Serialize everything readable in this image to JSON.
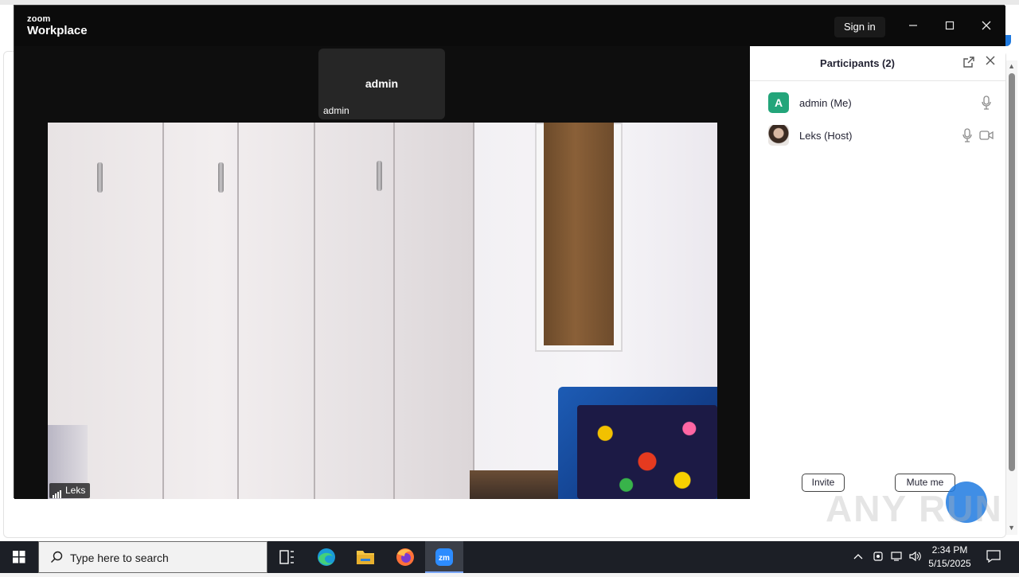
{
  "window": {
    "logo_top": "zoom",
    "logo_bottom": "Workplace",
    "sign_in": "Sign in"
  },
  "stage": {
    "thumbnail_name": "admin",
    "thumbnail_label": "admin",
    "main_video_label": "Leks"
  },
  "participants": {
    "title": "Participants (2)",
    "items": [
      {
        "avatar_letter": "A",
        "name": "admin (Me)",
        "avatar_color": "#23a57a"
      },
      {
        "name": "Leks (Host)"
      }
    ],
    "invite_label": "Invite",
    "mute_label": "Mute me"
  },
  "watermark": "ANY RUN",
  "taskbar": {
    "search_placeholder": "Type here to search",
    "time": "2:34 PM",
    "date": "5/15/2025"
  },
  "colors": {
    "accent": "#1f7ae0",
    "taskbar": "#1c1f26"
  }
}
